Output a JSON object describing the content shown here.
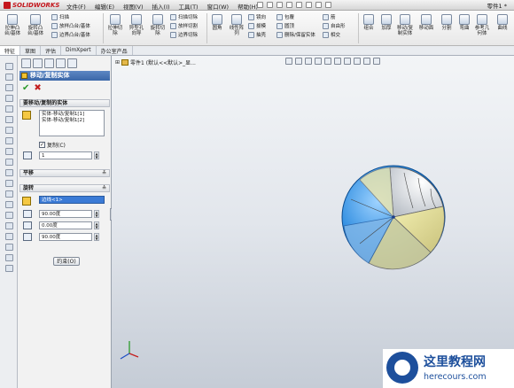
{
  "app": {
    "logo": "SOLIDWORKS",
    "document_title": "零件1 *"
  },
  "menu": [
    "文件(F)",
    "编辑(E)",
    "视图(V)",
    "插入(I)",
    "工具(T)",
    "窗口(W)",
    "帮助(H)"
  ],
  "ribbon": {
    "large": [
      {
        "label": "拉伸凸\n台/基体"
      },
      {
        "label": "旋转凸\n台/基体"
      },
      {
        "label": "拉伸切\n除"
      },
      {
        "label": "异型孔\n向导"
      },
      {
        "label": "旋转切\n除"
      },
      {
        "label": "线性阵\n列"
      },
      {
        "label": "移动/复\n制实体"
      },
      {
        "label": "移动面"
      },
      {
        "label": "分割"
      },
      {
        "label": "弯曲"
      },
      {
        "label": "参考几\n何体"
      },
      {
        "label": "曲线"
      }
    ],
    "small_col_a": [
      "扫描",
      "放样凸台/基体",
      "边界凸台/基体"
    ],
    "small_col_b": [
      "扫描切除",
      "放样切割",
      "边界切除"
    ],
    "small_col_c": [
      "筋",
      "包覆",
      "拔模",
      "抽壳",
      "镜向",
      "圆顶"
    ],
    "small_col_d": [
      "相交",
      "自由形",
      "删除/保留实体"
    ],
    "mid": [
      "圆角",
      "组合",
      "加厚"
    ]
  },
  "tabs": [
    "特征",
    "草图",
    "评估",
    "DimXpert",
    "办公室产品"
  ],
  "property_manager": {
    "title": "移动/复制实体",
    "ok": "✔",
    "cancel": "✖",
    "bodies_group": "要移动/复制的实体",
    "bodies": [
      "实体-移动/复制1[1]",
      "实体-移动/复制1[2]"
    ],
    "copy_label": "复制(C)",
    "copy_checked": true,
    "copies": "1",
    "translate_group": "平移",
    "rotate_group": "旋转",
    "rotate_ref": "边线<1>",
    "angles": [
      "90.00度",
      "0.00度",
      "90.00度"
    ],
    "constraint_button": "约束(O)"
  },
  "graphics": {
    "tree_root": "零件1 (默认<<默认>_显..."
  },
  "watermark": {
    "title": "这里教程网",
    "url": "herecours.com"
  },
  "colors": {
    "accent": "#3a67a8",
    "selection": "#3b7bd6",
    "brand": "#c4161c"
  }
}
